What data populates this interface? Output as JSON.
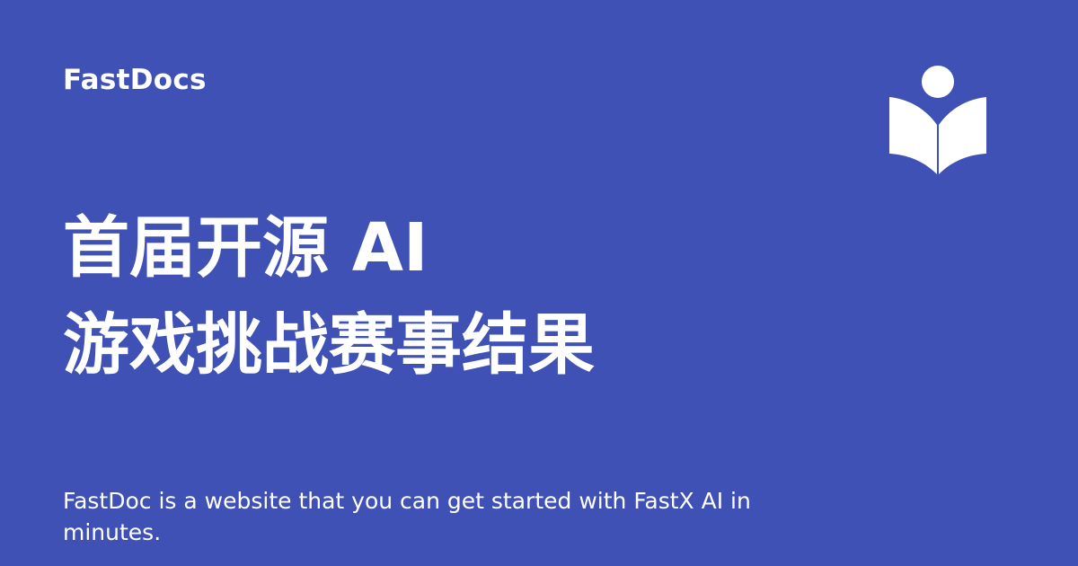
{
  "brand": {
    "name": "FastDocs",
    "icon": "open-book-reader-icon"
  },
  "title": {
    "line1": "首届开源 AI",
    "line2": "游戏挑战赛事结果"
  },
  "description": "FastDoc is a website that you can get started with FastX AI in minutes.",
  "colors": {
    "background": "#3f51b5",
    "text": "#ffffff",
    "icon": "#ffffff"
  }
}
